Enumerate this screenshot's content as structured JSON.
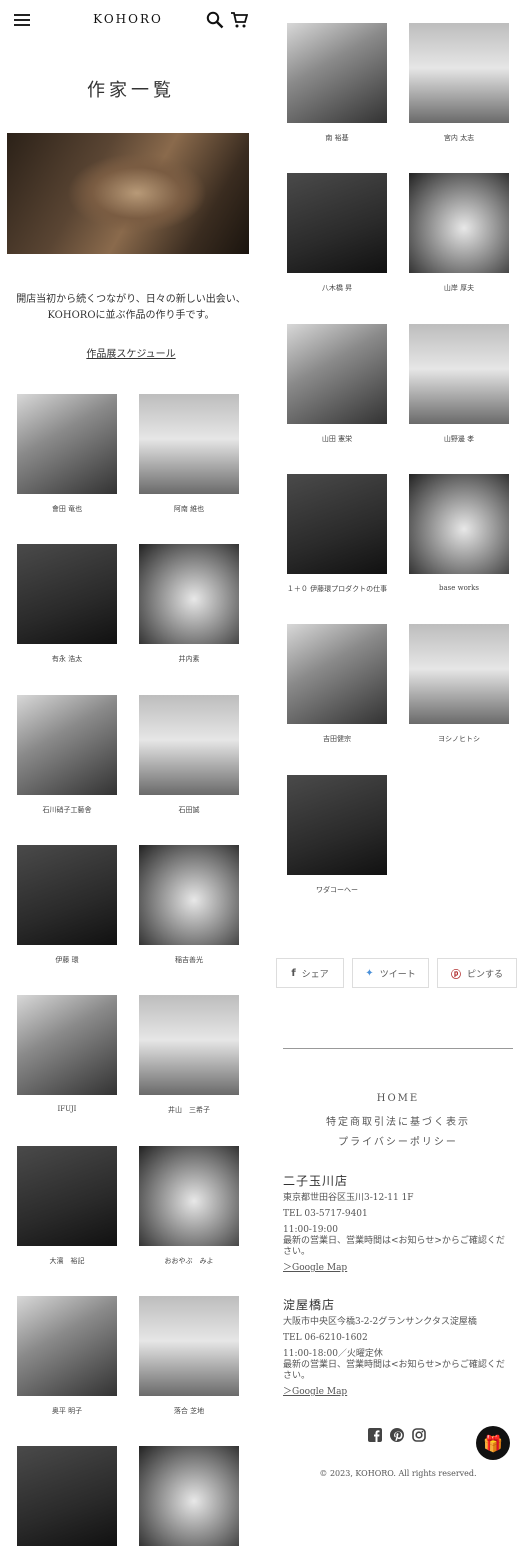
{
  "header": {
    "logo": "KOHORO",
    "menu_icon": "hamburger-icon",
    "search_icon": "search-icon",
    "cart_icon": "cart-icon"
  },
  "page": {
    "title": "作家一覧",
    "intro_line1": "開店当初から続くつながり、日々の新しい出会い、",
    "intro_line2": "KOHOROに並ぶ作品の作り手です。",
    "schedule_link": "作品展スケジュール"
  },
  "artists_left": [
    "會田 竜也",
    "阿南 維也",
    "有永 浩太",
    "井内素",
    "石川硝子工藝舎",
    "石田誠",
    "伊藤 環",
    "稲吉善光",
    "IFUJI",
    "井山　三希子",
    "大濱　裕記",
    "おおやぶ　みよ",
    "奥平 明子",
    "落合 芝地",
    "",
    ""
  ],
  "artists_right": [
    "南 裕基",
    "宮内 太志",
    "八木橋 昇",
    "山岸 厚夫",
    "山田 憲栄",
    "山野邊 孝",
    "１＋０ 伊藤環プロダクトの仕事",
    "base works",
    "吉田健宗",
    "ヨシノヒトシ",
    "ワダコーヘー"
  ],
  "share": {
    "facebook": "シェア",
    "twitter": "ツイート",
    "pinterest": "ピンする"
  },
  "footer": {
    "nav": [
      "HOME",
      "特定商取引法に基づく表示",
      "プライバシーポリシー"
    ],
    "store1": {
      "name": "二子玉川店",
      "address": "東京都世田谷区玉川3-12-11 1F",
      "tel": "TEL 03-5717-9401",
      "hours": "11:00-19:00",
      "note": "最新の営業日、営業時間は<お知らせ>からご確認ください。",
      "map": "＞Google Map"
    },
    "store2": {
      "name": "淀屋橋店",
      "address": "大阪市中央区今橋3-2-2グランサンクタス淀屋橋",
      "tel": "TEL 06-6210-1602",
      "hours": "11:00-18:00／火曜定休",
      "note": "最新の営業日、営業時間は<お知らせ>からご確認ください。",
      "map": "＞Google Map"
    },
    "social_icons": [
      "facebook-icon",
      "pinterest-icon",
      "instagram-icon"
    ],
    "copyright": "© 2023, KOHORO. All rights reserved."
  },
  "colors": {
    "text": "#333333",
    "rule": "#999999",
    "fab": "#111111"
  }
}
